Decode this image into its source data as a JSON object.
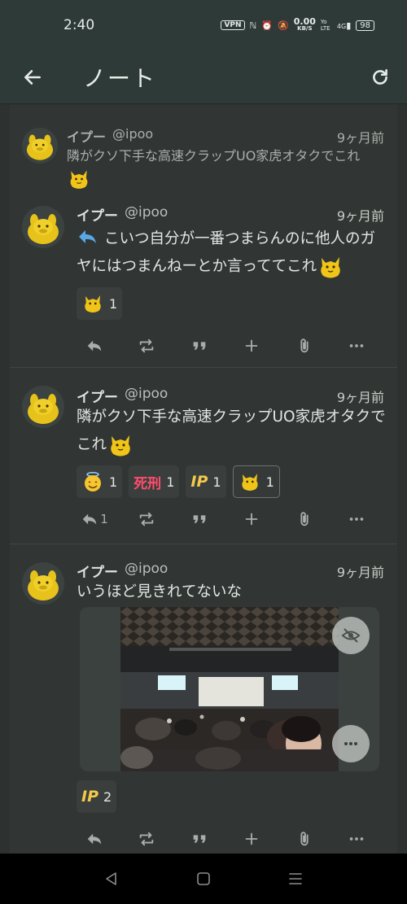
{
  "status": {
    "time": "2:40",
    "vpn": "VPN",
    "net_speed": "0.00",
    "net_unit": "KB/S",
    "volte": "Yo LTE",
    "signal": "4G",
    "battery": "98"
  },
  "appbar": {
    "title": "ノート"
  },
  "quoted_note": {
    "display_name": "イプー",
    "username": "@ipoo",
    "time": "9ヶ月前",
    "text": "隣がクソ下手な高速クラップUO家虎オタクでこれ"
  },
  "notes": [
    {
      "display_name": "イプー",
      "username": "@ipoo",
      "time": "9ヶ月前",
      "text": "こいつ自分が一番つまらんのに他人のガヤにはつまんねーとか言っててこれ",
      "reactions": [
        {
          "emoji": "ipoo-blob",
          "count": "1"
        }
      ],
      "reply_count": ""
    },
    {
      "display_name": "イプー",
      "username": "@ipoo",
      "time": "9ヶ月前",
      "text": "隣がクソ下手な高速クラップUO家虎オタクでこれ",
      "reactions": [
        {
          "emoji": "angel-face",
          "count": "1"
        },
        {
          "emoji": "死刑",
          "count": "1"
        },
        {
          "emoji": "IP",
          "count": "1"
        },
        {
          "emoji": "ipoo-blob",
          "count": "1"
        }
      ],
      "reply_count": "1"
    },
    {
      "display_name": "イプー",
      "username": "@ipoo",
      "time": "9ヶ月前",
      "text": "いうほど見きれてないな",
      "reactions": [
        {
          "emoji": "IP",
          "count": "2"
        }
      ],
      "reply_count": ""
    }
  ],
  "icons": {
    "reply": "reply-icon",
    "renote": "renote-icon",
    "quote": "quote-icon",
    "react": "plus-icon",
    "clip": "paperclip-icon",
    "more": "more-icon"
  },
  "colors": {
    "background": "#2d3230",
    "appbar": "#2e3a37",
    "accent_reply": "#5aa7e6",
    "emoji_yellow": "#f0c419"
  }
}
